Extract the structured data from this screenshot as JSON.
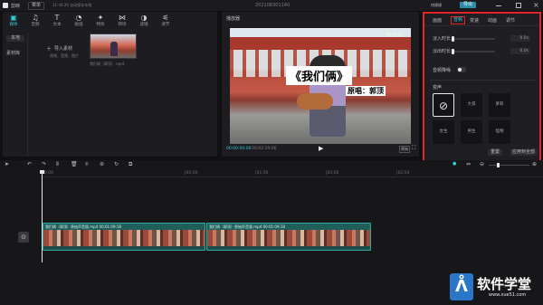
{
  "titlebar": {
    "app_name": "剪映",
    "menu_label": "菜单",
    "autosave": "11:44:26 自动保存本地",
    "project_title": "20210830114​0",
    "shortcut_label": "快捷键",
    "export_label": "导出",
    "window_controls": [
      "minimize-icon",
      "maximize-icon",
      "close-icon"
    ]
  },
  "media_panel": {
    "tabs": [
      {
        "label": "媒体",
        "icon": "media-icon",
        "active": true
      },
      {
        "label": "音频",
        "icon": "audio-icon",
        "active": false
      },
      {
        "label": "文本",
        "icon": "text-icon",
        "active": false
      },
      {
        "label": "贴纸",
        "icon": "sticker-icon",
        "active": false
      },
      {
        "label": "特效",
        "icon": "effects-icon",
        "active": false
      },
      {
        "label": "转场",
        "icon": "transition-icon",
        "active": false
      },
      {
        "label": "滤镜",
        "icon": "filter-icon",
        "active": false
      },
      {
        "label": "调节",
        "icon": "adjust-icon",
        "active": false
      }
    ],
    "side_items": [
      "本地",
      "素材库"
    ],
    "import_label": "导入素材",
    "import_hint": "视频、音频、图片",
    "clip_thumb_caption": "我们俩（郭顶）.mp4"
  },
  "player": {
    "title": "播放器",
    "video_title": "《我们俩》",
    "video_subtitle": "原唱：郭顶",
    "watermark": "QQ音乐",
    "current_time": "00:00:00:00",
    "total_time": "00:02:19:06",
    "ratio_label": "原始"
  },
  "inspector": {
    "tabs": [
      "画面",
      "音频",
      "变速",
      "动画",
      "调节"
    ],
    "active_tab": "音频",
    "fade_in_label": "淡入时长",
    "fade_in_value": "0.0s",
    "fade_out_label": "淡出时长",
    "fade_out_value": "0.0s",
    "normalize_label": "音频降噪",
    "voice_section": "变声",
    "voices": [
      "无",
      "大叔",
      "萝莉",
      "女生",
      "男生",
      "怪物"
    ],
    "reset_label": "重置",
    "apply_all_label": "应用到全部"
  },
  "timeline": {
    "ruler": [
      "00:00",
      "|00:50",
      "|01:50",
      "|02:00",
      "|02:50"
    ],
    "clips": [
      {
        "caption": "我们俩（郭顶）原始声音版.mp4   00:01:09:18"
      },
      {
        "caption": "我们俩（郭顶）原始声音版.mp4   00:01:09:18"
      }
    ]
  },
  "watermark": {
    "name": "软件学堂",
    "url": "www.xue51.com"
  },
  "colors": {
    "accent": "#2fd0d6",
    "highlight_border": "#e3262a",
    "clip_fill": "#1f5e5b"
  }
}
